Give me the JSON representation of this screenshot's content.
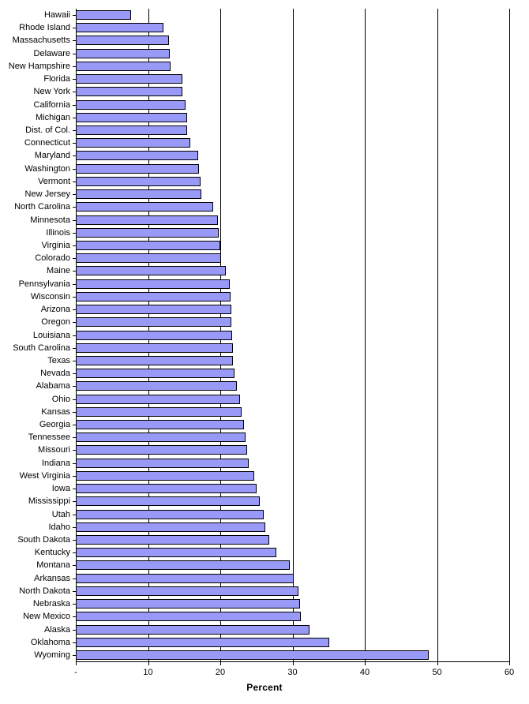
{
  "chart_data": {
    "type": "bar",
    "orientation": "horizontal",
    "title": "",
    "xlabel": "Percent",
    "ylabel": "",
    "xlim": [
      0,
      60
    ],
    "xticks": [
      "-",
      "10",
      "20",
      "30",
      "40",
      "50",
      "60"
    ],
    "xtick_values": [
      0,
      10,
      20,
      30,
      40,
      50,
      60
    ],
    "grid": "vertical",
    "legend": "none",
    "bar_color": "#9999f7",
    "bar_border_color": "#000000",
    "categories": [
      "Hawaii",
      "Rhode Island",
      "Massachusetts",
      "Delaware",
      "New Hampshire",
      "Florida",
      "New York",
      "California",
      "Michigan",
      "Dist. of Col.",
      "Connecticut",
      "Maryland",
      "Washington",
      "Vermont",
      "New Jersey",
      "North Carolina",
      "Minnesota",
      "Illinois",
      "Virginia",
      "Colorado",
      "Maine",
      "Pennsylvania",
      "Wisconsin",
      "Arizona",
      "Oregon",
      "Louisiana",
      "South Carolina",
      "Texas",
      "Nevada",
      "Alabama",
      "Ohio",
      "Kansas",
      "Georgia",
      "Tennessee",
      "Missouri",
      "Indiana",
      "West Virginia",
      "Iowa",
      "Mississippi",
      "Utah",
      "Idaho",
      "South Dakota",
      "Kentucky",
      "Montana",
      "Arkansas",
      "North Dakota",
      "Nebraska",
      "New Mexico",
      "Alaska",
      "Oklahoma",
      "Wyoming"
    ],
    "values": [
      7.6,
      12.1,
      12.9,
      13.0,
      13.1,
      14.7,
      14.8,
      15.2,
      15.4,
      15.4,
      15.8,
      16.9,
      17.0,
      17.3,
      17.4,
      19.0,
      19.7,
      19.8,
      20.0,
      20.1,
      20.8,
      21.3,
      21.4,
      21.5,
      21.5,
      21.6,
      21.7,
      21.8,
      22.0,
      22.3,
      22.7,
      22.9,
      23.3,
      23.5,
      23.7,
      23.9,
      24.7,
      25.0,
      25.5,
      26.0,
      26.2,
      26.8,
      27.8,
      29.6,
      30.2,
      30.8,
      31.0,
      31.2,
      32.4,
      35.1,
      48.9
    ]
  },
  "axis": {
    "xlabel": "Percent"
  }
}
